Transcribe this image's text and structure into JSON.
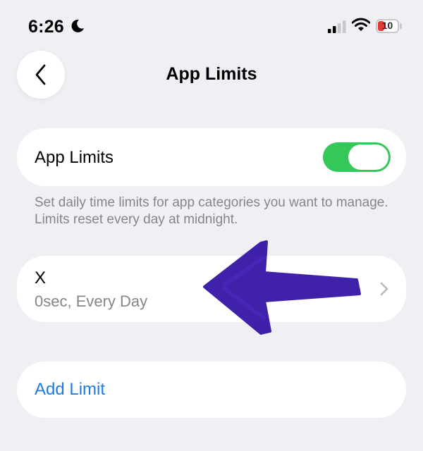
{
  "status_bar": {
    "time": "6:26",
    "battery_level": "10",
    "focus_icon": "moon-icon",
    "signal_icon": "cellular-signal-icon",
    "wifi_icon": "wifi-icon"
  },
  "nav": {
    "title": "App Limits",
    "back_icon": "chevron-left-icon"
  },
  "app_limits_toggle": {
    "label": "App Limits",
    "enabled": true
  },
  "description": "Set daily time limits for app categories you want to manage. Limits reset every day at midnight.",
  "limits": [
    {
      "name": "X",
      "detail": "0sec, Every Day"
    }
  ],
  "add_limit_label": "Add Limit",
  "colors": {
    "background": "#efeff4",
    "toggle_on": "#34c759",
    "link_blue": "#1f7ae0",
    "secondary_text": "#85858b",
    "annotation_purple": "#3a1aa8"
  }
}
